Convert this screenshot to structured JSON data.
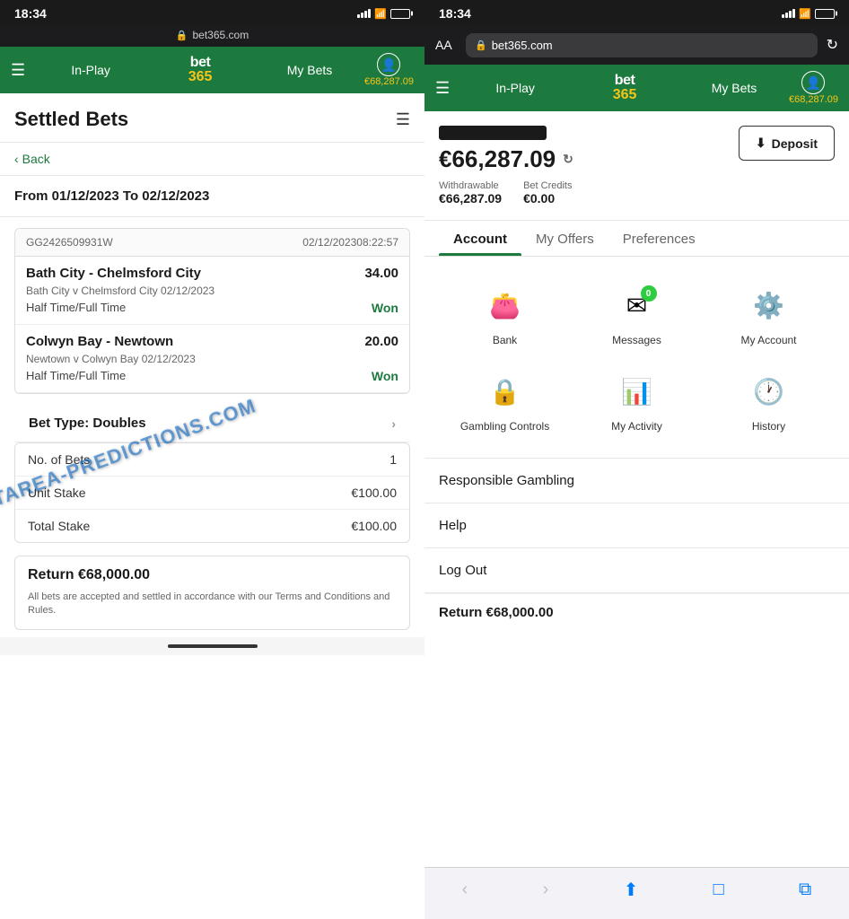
{
  "left": {
    "status": {
      "time": "18:34",
      "url": "bet365.com"
    },
    "nav": {
      "menu_label": "☰",
      "in_play": "In-Play",
      "logo_bet": "bet",
      "logo_365": "365",
      "my_bets": "My Bets",
      "balance": "€68,287.09"
    },
    "page_title": "Settled Bets",
    "back_label": "Back",
    "date_range": "From 01/12/2023 To 02/12/2023",
    "bet_ref": "GG2426509931W",
    "bet_date": "02/12/202308:22:57",
    "bets": [
      {
        "title": "Bath City - Chelmsford City",
        "odds": "34.00",
        "subtitle": "Bath City v Chelmsford City 02/12/2023",
        "market": "Half Time/Full Time",
        "result": "Won"
      },
      {
        "title": "Colwyn Bay - Newtown",
        "odds": "20.00",
        "subtitle": "Newtown v Colwyn Bay 02/12/2023",
        "market": "Half Time/Full Time",
        "result": "Won"
      }
    ],
    "bet_type_label": "Bet Type: Doubles",
    "stats": [
      {
        "label": "No. of Bets",
        "value": "1"
      },
      {
        "label": "Unit Stake",
        "value": "€100.00"
      },
      {
        "label": "Total Stake",
        "value": "€100.00"
      }
    ],
    "return_label": "Return €68,000.00",
    "disclaimer": "All bets are accepted and settled in accordance with our Terms and Conditions and Rules.",
    "watermark": "STATAREA-PREDICTIONS.COM"
  },
  "right": {
    "status": {
      "time": "18:34"
    },
    "browser": {
      "aa": "AA",
      "lock_icon": "🔒",
      "url": "bet365.com",
      "refresh": "↻"
    },
    "nav": {
      "menu_label": "☰",
      "in_play": "In-Play",
      "logo_bet": "bet",
      "logo_365": "365",
      "my_bets": "My Bets",
      "balance": "€68,287.09"
    },
    "account": {
      "main_balance": "€66,287.09",
      "withdrawable_label": "Withdrawable",
      "withdrawable_value": "€66,287.09",
      "bet_credits_label": "Bet Credits",
      "bet_credits_value": "€0.00",
      "deposit_label": "Deposit"
    },
    "tabs": [
      {
        "id": "account",
        "label": "Account",
        "active": true
      },
      {
        "id": "my-offers",
        "label": "My Offers",
        "active": false
      },
      {
        "id": "preferences",
        "label": "Preferences",
        "active": false
      }
    ],
    "menu_items": [
      {
        "id": "bank",
        "label": "Bank",
        "icon": "wallet"
      },
      {
        "id": "messages",
        "label": "Messages",
        "icon": "message",
        "badge": "0"
      },
      {
        "id": "my-account",
        "label": "My Account",
        "icon": "user"
      },
      {
        "id": "gambling",
        "label": "Gambling Controls",
        "icon": "shield"
      },
      {
        "id": "my-activity",
        "label": "My Activity",
        "icon": "chart"
      },
      {
        "id": "history",
        "label": "History",
        "icon": "clock"
      }
    ],
    "list_items": [
      {
        "id": "responsible-gambling",
        "label": "Responsible Gambling"
      },
      {
        "id": "help",
        "label": "Help"
      },
      {
        "id": "log-out",
        "label": "Log Out"
      }
    ],
    "bottom_peek": "Return €68,000.00",
    "browser_nav": {
      "back": "‹",
      "forward": "›",
      "share": "⬆",
      "bookmarks": "□",
      "tabs": "⧉"
    }
  }
}
